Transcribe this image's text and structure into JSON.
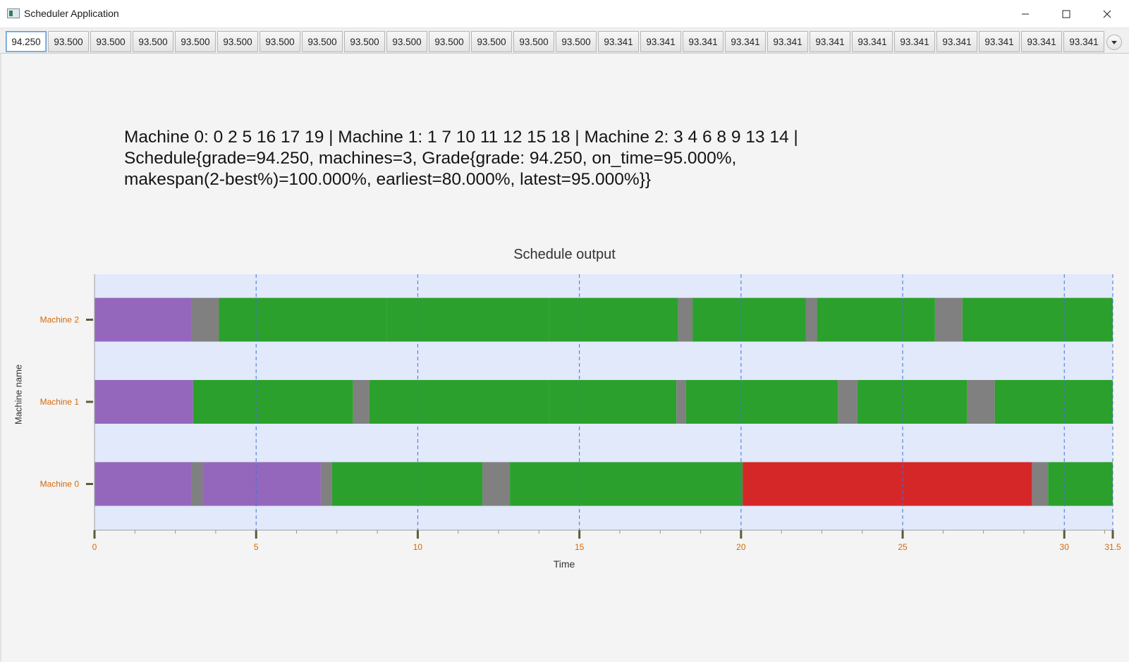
{
  "window": {
    "title": "Scheduler Application"
  },
  "tabs": [
    "94.250",
    "93.500",
    "93.500",
    "93.500",
    "93.500",
    "93.500",
    "93.500",
    "93.500",
    "93.500",
    "93.500",
    "93.500",
    "93.500",
    "93.500",
    "93.500",
    "93.341",
    "93.341",
    "93.341",
    "93.341",
    "93.341",
    "93.341",
    "93.341",
    "93.341",
    "93.341",
    "93.341",
    "93.341",
    "93.341"
  ],
  "selected_tab": 0,
  "summary": {
    "line1": "Machine 0: 0 2 5 16 17 19 | Machine 1: 1 7 10 11 12 15 18 | Machine 2: 3 4 6 8 9 13 14 |",
    "line2": "Schedule{grade=94.250, machines=3, Grade{grade: 94.250, on_time=95.000%,",
    "line3": "makespan(2-best%)=100.000%, earliest=80.000%, latest=95.000%}}"
  },
  "chart_data": {
    "type": "gantt",
    "title": "Schedule output",
    "xlabel": "Time",
    "ylabel": "Machine name",
    "xlim": [
      0,
      31.5
    ],
    "x_ticks": [
      "0",
      "5",
      "10",
      "15",
      "20",
      "25",
      "30",
      "31.5"
    ],
    "categories": [
      "Machine 2",
      "Machine 1",
      "Machine 0"
    ],
    "colors": {
      "purple": "#9467bd",
      "gray": "#808080",
      "green": "#2ca02c",
      "red": "#d62728",
      "plot_bg": "#e1e9fa",
      "grid": "#3f73d6",
      "axis_text": "#d4690a"
    },
    "rows": [
      {
        "name": "Machine 2",
        "segments": [
          {
            "start": 0,
            "end": 3.0,
            "color": "purple"
          },
          {
            "start": 3.0,
            "end": 3.85,
            "color": "gray"
          },
          {
            "start": 3.85,
            "end": 9.05,
            "color": "green"
          },
          {
            "start": 9.05,
            "end": 14.05,
            "color": "green"
          },
          {
            "start": 14.05,
            "end": 18.05,
            "color": "green"
          },
          {
            "start": 18.05,
            "end": 18.5,
            "color": "gray"
          },
          {
            "start": 18.5,
            "end": 22.0,
            "color": "green"
          },
          {
            "start": 22.0,
            "end": 22.35,
            "color": "gray"
          },
          {
            "start": 22.35,
            "end": 26.0,
            "color": "green"
          },
          {
            "start": 26.0,
            "end": 26.85,
            "color": "gray"
          },
          {
            "start": 26.85,
            "end": 31.5,
            "color": "green"
          }
        ]
      },
      {
        "name": "Machine 1",
        "segments": [
          {
            "start": 0,
            "end": 3.05,
            "color": "purple"
          },
          {
            "start": 3.05,
            "end": 8.0,
            "color": "green"
          },
          {
            "start": 8.0,
            "end": 8.5,
            "color": "gray"
          },
          {
            "start": 8.5,
            "end": 14.05,
            "color": "green"
          },
          {
            "start": 14.05,
            "end": 18.0,
            "color": "green"
          },
          {
            "start": 18.0,
            "end": 18.3,
            "color": "gray"
          },
          {
            "start": 18.3,
            "end": 23.0,
            "color": "green"
          },
          {
            "start": 23.0,
            "end": 23.6,
            "color": "gray"
          },
          {
            "start": 23.6,
            "end": 27.0,
            "color": "green"
          },
          {
            "start": 27.0,
            "end": 27.85,
            "color": "gray"
          },
          {
            "start": 27.85,
            "end": 31.5,
            "color": "green"
          }
        ]
      },
      {
        "name": "Machine 0",
        "segments": [
          {
            "start": 0,
            "end": 3.0,
            "color": "purple"
          },
          {
            "start": 3.0,
            "end": 3.35,
            "color": "gray"
          },
          {
            "start": 3.35,
            "end": 7.0,
            "color": "purple"
          },
          {
            "start": 7.0,
            "end": 7.35,
            "color": "gray"
          },
          {
            "start": 7.35,
            "end": 12.0,
            "color": "green"
          },
          {
            "start": 12.0,
            "end": 12.85,
            "color": "gray"
          },
          {
            "start": 12.85,
            "end": 20.05,
            "color": "green"
          },
          {
            "start": 20.05,
            "end": 29.0,
            "color": "red"
          },
          {
            "start": 29.0,
            "end": 29.5,
            "color": "gray"
          },
          {
            "start": 29.5,
            "end": 31.5,
            "color": "green"
          }
        ]
      }
    ]
  }
}
